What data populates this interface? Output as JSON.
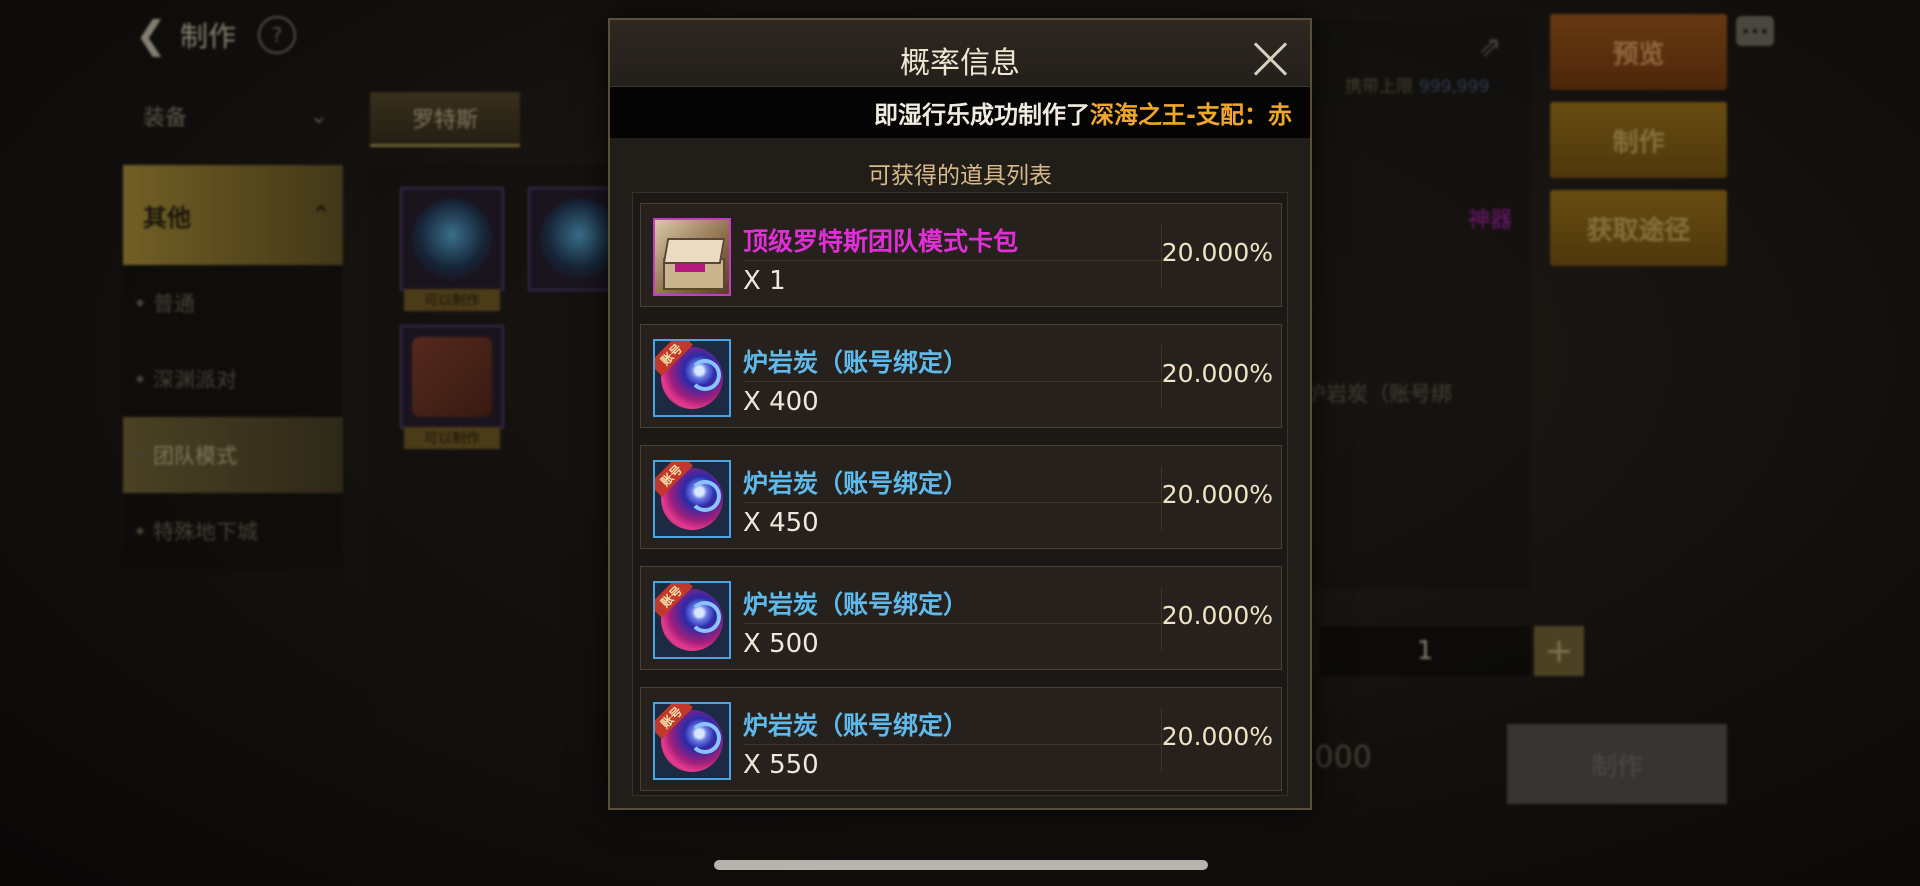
{
  "background": {
    "topbar": {
      "back_icon": "back-arrow-icon",
      "title": "制作",
      "help_icon": "help-icon"
    },
    "filter_dropdown": {
      "label": "装备"
    },
    "side_menu": {
      "category": "其他",
      "items": [
        {
          "label": "普通"
        },
        {
          "label": "深渊派对"
        },
        {
          "label": "团队模式"
        },
        {
          "label": "特殊地下城"
        }
      ]
    },
    "content_tab": "罗特斯",
    "grid_badges": [
      "可以制作",
      "可以制作"
    ],
    "limit_label": "携带上限",
    "limit_value": "999,999",
    "tag": "神器",
    "item_name_partial": "炉岩炭（账号绑",
    "quantity": "1",
    "cost_partial": ",000",
    "buttons": {
      "preview": "预览",
      "craft": "制作",
      "source": "获取途径",
      "craft_bottom": "制作"
    }
  },
  "modal": {
    "title": "概率信息",
    "notice_prefix": "即湿行乐成功制作了",
    "notice_item": "深海之王-支配：赤",
    "list_title": "可获得的道具列表",
    "rewards": [
      {
        "name": "顶级罗特斯团队模式卡包",
        "qty": "X 1",
        "rate": "20.000%",
        "icon": "card-pack-icon",
        "rarity_color": "#e02fd6"
      },
      {
        "name": "炉岩炭（账号绑定）",
        "qty": "X 400",
        "rate": "20.000%",
        "icon": "lava-coal-icon",
        "rarity_color": "#5fb9ea"
      },
      {
        "name": "炉岩炭（账号绑定）",
        "qty": "X 450",
        "rate": "20.000%",
        "icon": "lava-coal-icon",
        "rarity_color": "#5fb9ea"
      },
      {
        "name": "炉岩炭（账号绑定）",
        "qty": "X 500",
        "rate": "20.000%",
        "icon": "lava-coal-icon",
        "rarity_color": "#5fb9ea"
      },
      {
        "name": "炉岩炭（账号绑定）",
        "qty": "X 550",
        "rate": "20.000%",
        "icon": "lava-coal-icon",
        "rarity_color": "#5fb9ea"
      }
    ],
    "account_tag": "账号"
  }
}
